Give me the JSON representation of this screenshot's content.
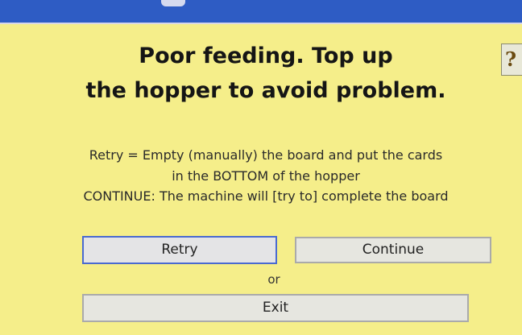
{
  "dialog": {
    "help_symbol": "?",
    "headline": {
      "line1": "Poor feeding. Top up",
      "line2": "the hopper to avoid problem."
    },
    "info": {
      "line1": "Retry = Empty (manually) the board and put the cards",
      "line2": "in the BOTTOM of the hopper",
      "line3": "CONTINUE: The machine will [try to] complete the board"
    },
    "buttons": {
      "retry": "Retry",
      "continue": "Continue",
      "or": "or",
      "exit": "Exit"
    },
    "colors": {
      "background": "#f5ee8a",
      "titlebar": "#2e5cc4",
      "focus_border": "#4a6ad0"
    }
  }
}
